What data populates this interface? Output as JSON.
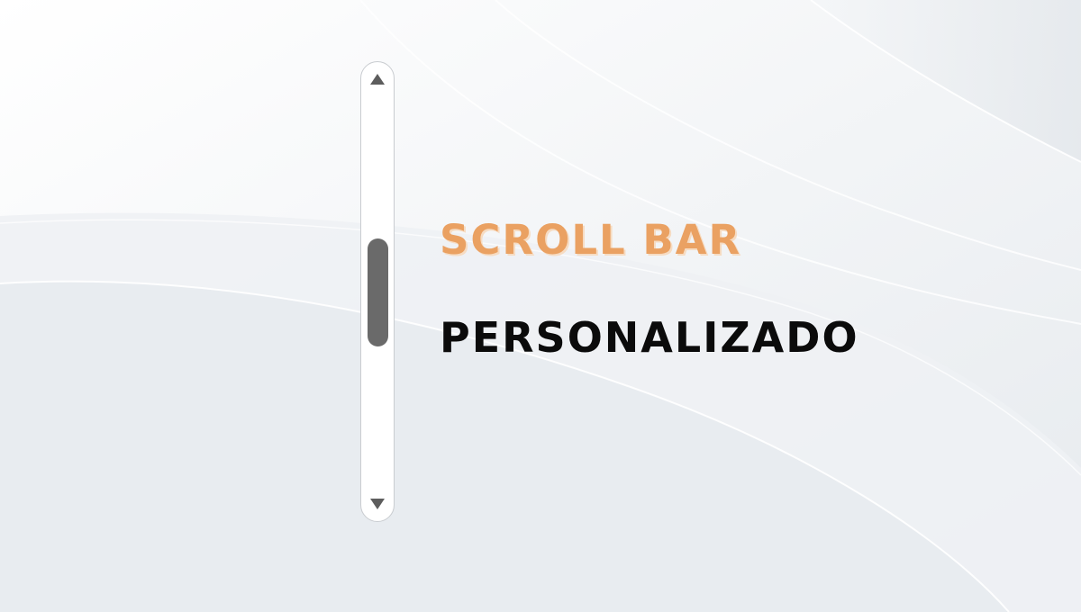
{
  "headline": {
    "line1": "SCROLL BAR",
    "line2": "PERSONALIZADO"
  },
  "scrollbar": {
    "up_icon": "triangle-up-icon",
    "down_icon": "triangle-down-icon",
    "scroll_position": 0.45
  },
  "colors": {
    "accent": "#eaa162",
    "text": "#0b0b0b",
    "thumb": "#6a6a6a",
    "arrows": "#5d5d5d",
    "background": "#eef1f4"
  }
}
